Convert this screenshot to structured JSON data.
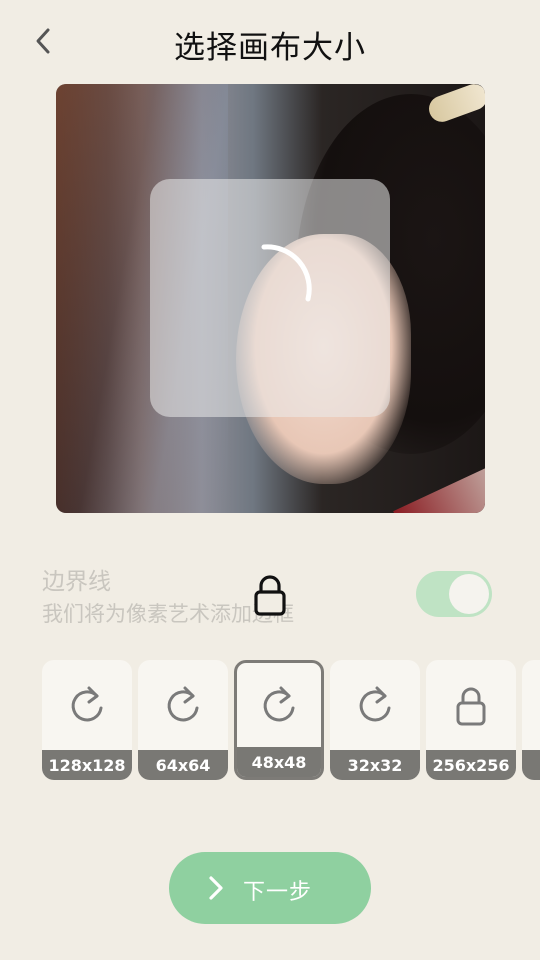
{
  "header": {
    "title": "选择画布大小",
    "back_icon": "chevron-left-icon"
  },
  "preview": {
    "loading": true,
    "spinner_icon": "loading-spinner-icon"
  },
  "border": {
    "title": "边界线",
    "subtitle": "我们将为像素艺术添加边框",
    "locked": true,
    "lock_icon": "lock-icon",
    "toggle_on": true
  },
  "sizes": [
    {
      "label": "128x128",
      "icon": "refresh-icon",
      "selected": false
    },
    {
      "label": "64x64",
      "icon": "refresh-icon",
      "selected": false
    },
    {
      "label": "48x48",
      "icon": "refresh-icon",
      "selected": true
    },
    {
      "label": "32x32",
      "icon": "refresh-icon",
      "selected": false
    },
    {
      "label": "256x256",
      "icon": "lock-icon",
      "selected": false
    },
    {
      "label": "",
      "icon": "",
      "selected": false
    }
  ],
  "next_button": {
    "label": "下一步",
    "icon": "chevron-right-icon"
  },
  "colors": {
    "background": "#f1ede4",
    "accent": "#8fd0a0",
    "toggle_on": "#bfe3c4",
    "label_bg": "#797874"
  }
}
